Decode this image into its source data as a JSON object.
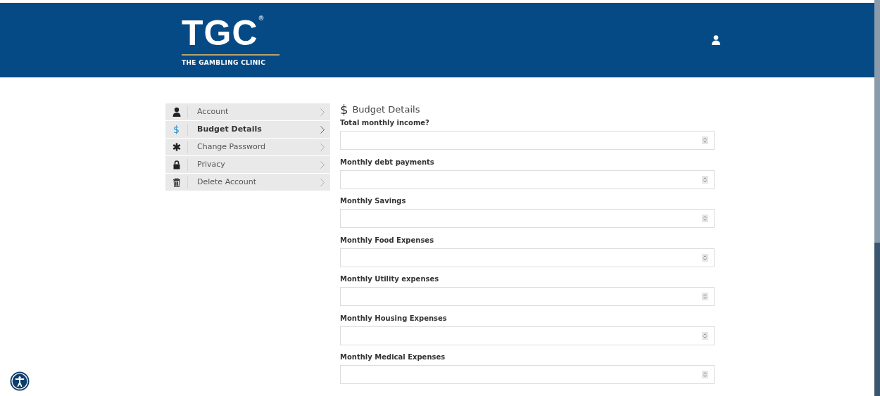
{
  "header": {
    "logo": {
      "letters": "TGC",
      "mark": "®",
      "tagline": "THE GAMBLING CLINIC"
    }
  },
  "sidebar": {
    "items": [
      {
        "kind": "user",
        "label": "Account",
        "selected": false
      },
      {
        "kind": "glyph",
        "glyph": "$",
        "label": "Budget Details",
        "selected": true
      },
      {
        "kind": "asterisk",
        "label": "Change Password",
        "selected": false
      },
      {
        "kind": "lock",
        "label": "Privacy",
        "selected": false
      },
      {
        "kind": "trash",
        "label": "Delete Account",
        "selected": false
      }
    ]
  },
  "form": {
    "title": "Budget Details",
    "title_icon": "$",
    "fields": [
      {
        "label": "Total monthly income?"
      },
      {
        "label": "Monthly debt payments"
      },
      {
        "label": "Monthly Savings"
      },
      {
        "label": "Monthly Food Expenses"
      },
      {
        "label": "Monthly Utility expenses"
      },
      {
        "label": "Monthly Housing Expenses"
      },
      {
        "label": "Monthly Medical Expenses"
      }
    ]
  }
}
